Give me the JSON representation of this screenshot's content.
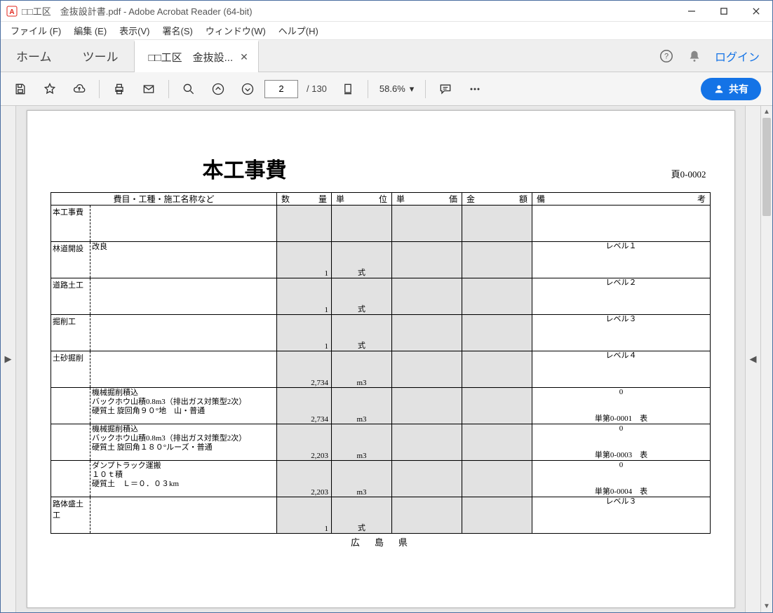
{
  "titlebar": {
    "title": "□□工区　金抜設計書.pdf - Adobe Acrobat Reader (64-bit)"
  },
  "menubar": [
    "ファイル (F)",
    "編集 (E)",
    "表示(V)",
    "署名(S)",
    "ウィンドウ(W)",
    "ヘルプ(H)"
  ],
  "tabs": {
    "home": "ホーム",
    "tools": "ツール",
    "doc": "□□工区　金抜設...",
    "login": "ログイン"
  },
  "toolbar": {
    "page_current": "2",
    "page_total": "/ 130",
    "zoom": "58.6%",
    "share": "共有"
  },
  "doc": {
    "title": "本工事費",
    "page_code": "頁0-0002",
    "footer": "広　島　県",
    "headers": {
      "name": "費目・工種・施工名称など",
      "qtyL": "数",
      "qtyR": "量",
      "unitL": "単",
      "unitR": "位",
      "upriceL": "単",
      "upriceR": "価",
      "amountL": "金",
      "amountR": "額",
      "noteL": "備",
      "noteR": "考"
    },
    "rows": [
      {
        "c1": "本工事費",
        "c2": "",
        "qty": "",
        "unit": "",
        "note_top": "",
        "note_bot": ""
      },
      {
        "c1": "林道開設",
        "c2": "改良",
        "qty": "1",
        "unit": "式",
        "note_top": "レベル１",
        "note_bot": ""
      },
      {
        "c1": "道路土工",
        "c2": "",
        "qty": "1",
        "unit": "式",
        "note_top": "レベル２",
        "note_bot": ""
      },
      {
        "c1": "掘削工",
        "c2": "",
        "qty": "1",
        "unit": "式",
        "note_top": "レベル３",
        "note_bot": ""
      },
      {
        "c1": "土砂掘削",
        "c2": "",
        "qty": "2,734",
        "unit": "m3",
        "note_top": "レベル４",
        "note_bot": ""
      },
      {
        "c1": "",
        "c2": "機械掘削積込\nバックホウ山積0.8m3（排出ガス対策型2次）\n硬質土 旋回角９０°地　山・普通",
        "qty": "2,734",
        "unit": "m3",
        "note_top": "0",
        "note_bot": "単第0-0001　表"
      },
      {
        "c1": "",
        "c2": "機械掘削積込\nバックホウ山積0.8m3（排出ガス対策型2次）\n硬質土 旋回角１８０°ルーズ・普通",
        "qty": "2,203",
        "unit": "m3",
        "note_top": "0",
        "note_bot": "単第0-0003　表"
      },
      {
        "c1": "",
        "c2": "ダンプトラック運搬\n１０ｔ積\n硬質土　Ｌ＝０．０３km",
        "qty": "2,203",
        "unit": "m3",
        "note_top": "0",
        "note_bot": "単第0-0004　表"
      },
      {
        "c1": "路体盛土工",
        "c2": "",
        "qty": "1",
        "unit": "式",
        "note_top": "レベル３",
        "note_bot": ""
      }
    ]
  }
}
